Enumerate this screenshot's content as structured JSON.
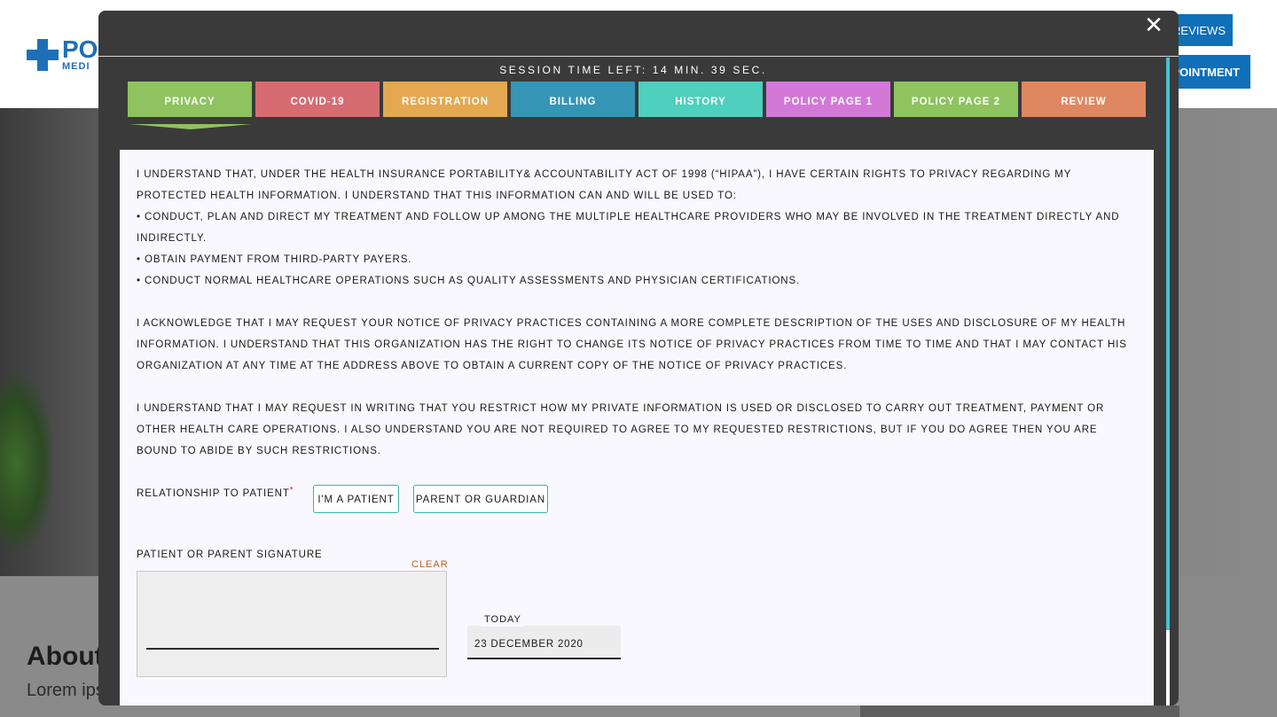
{
  "background": {
    "logo_big": "PO",
    "logo_small": "MEDI",
    "reviews_label": "REVIEWS",
    "appointment_label": "POINTMENT",
    "about_heading": "About",
    "lorem_text": "Lorem ips"
  },
  "modal": {
    "close_glyph": "✕",
    "session_text": "SESSION TIME LEFT: 14 MIN. 39 SEC.",
    "tabs": [
      {
        "label": "PRIVACY"
      },
      {
        "label": "COVID-19"
      },
      {
        "label": "REGISTRATION"
      },
      {
        "label": "BILLING"
      },
      {
        "label": "HISTORY"
      },
      {
        "label": "POLICY PAGE 1"
      },
      {
        "label": "POLICY PAGE 2"
      },
      {
        "label": "REVIEW"
      }
    ],
    "paragraphs": {
      "p1": "I UNDERSTAND THAT, UNDER THE HEALTH INSURANCE PORTABILITY& ACCOUNTABILITY ACT OF 1998 (“HIPAA”), I HAVE CERTAIN RIGHTS TO PRIVACY REGARDING MY PROTECTED HEALTH INFORMATION. I UNDERSTAND THAT THIS INFORMATION CAN AND WILL BE USED TO:",
      "b1": "• CONDUCT, PLAN AND DIRECT MY TREATMENT AND FOLLOW UP AMONG THE MULTIPLE HEALTHCARE PROVIDERS WHO MAY BE INVOLVED IN THE TREATMENT DIRECTLY AND INDIRECTLY.",
      "b2": "• OBTAIN PAYMENT FROM THIRD-PARTY PAYERS.",
      "b3": "• CONDUCT NORMAL HEALTHCARE OPERATIONS SUCH AS QUALITY ASSESSMENTS AND PHYSICIAN CERTIFICATIONS.",
      "p2": "I ACKNOWLEDGE THAT I MAY REQUEST YOUR NOTICE OF PRIVACY PRACTICES CONTAINING A MORE COMPLETE DESCRIPTION OF THE USES AND DISCLOSURE OF MY HEALTH INFORMATION. I UNDERSTAND THAT THIS ORGANIZATION HAS THE RIGHT TO CHANGE ITS NOTICE OF PRIVACY PRACTICES FROM TIME TO TIME AND THAT I MAY CONTACT HIS ORGANIZATION AT ANY TIME AT THE ADDRESS ABOVE TO OBTAIN A CURRENT COPY OF THE NOTICE OF PRIVACY PRACTICES.",
      "p3": "I UNDERSTAND THAT I MAY REQUEST IN WRITING THAT YOU RESTRICT HOW MY PRIVATE INFORMATION IS USED OR DISCLOSED TO CARRY OUT TREATMENT, PAYMENT OR OTHER HEALTH CARE OPERATIONS. I ALSO UNDERSTAND YOU ARE NOT REQUIRED TO AGREE TO MY REQUESTED RESTRICTIONS, BUT IF YOU DO AGREE THEN YOU ARE BOUND TO ABIDE BY SUCH RESTRICTIONS."
    },
    "relationship": {
      "label": "RELATIONSHIP TO PATIENT",
      "required_mark": "*",
      "option_patient": "I'M A PATIENT",
      "option_parent": "PARENT OR GUARDIAN"
    },
    "signature": {
      "label": "PATIENT OR PARENT SIGNATURE",
      "clear_label": "CLEAR"
    },
    "date": {
      "label": "TODAY",
      "value": "23 DECEMBER 2020"
    }
  }
}
